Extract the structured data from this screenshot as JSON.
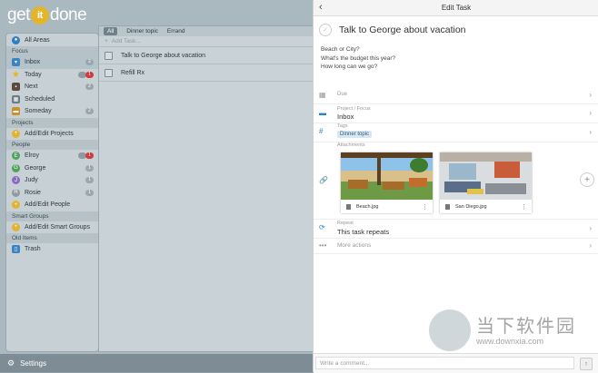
{
  "app": {
    "logo_left": "get",
    "logo_it": "it",
    "logo_right": "done"
  },
  "sidebar": {
    "all_areas": "All Areas",
    "sections": {
      "focus": "Focus",
      "projects": "Projects",
      "people": "People",
      "smart_groups": "Smart Groups",
      "old_items": "Old Items"
    },
    "focus_items": [
      {
        "label": "Inbox",
        "badge": "2"
      },
      {
        "label": "Today",
        "badge": "1"
      },
      {
        "label": "Next",
        "badge": "2"
      },
      {
        "label": "Scheduled",
        "badge": ""
      },
      {
        "label": "Someday",
        "badge": "2"
      }
    ],
    "add_projects": "Add/Edit Projects",
    "people": [
      {
        "initial": "E",
        "label": "Elroy",
        "badge": "1"
      },
      {
        "initial": "G",
        "label": "George",
        "badge": "1"
      },
      {
        "initial": "J",
        "label": "Judy",
        "badge": "1"
      },
      {
        "initial": "R",
        "label": "Rosie",
        "badge": "1"
      }
    ],
    "add_people": "Add/Edit People",
    "add_smart_groups": "Add/Edit Smart Groups",
    "trash": "Trash",
    "colors": {
      "elroy": "#4fa35a",
      "george": "#4fa35a",
      "judy": "#8a6bc2",
      "rosie": "#8f9aa0"
    }
  },
  "main": {
    "tabs": [
      "All",
      "Dinner topic",
      "Errand"
    ],
    "add_task": "Add Task...",
    "tasks": [
      "Talk to George about vacation",
      "Refill Rx"
    ]
  },
  "footer": {
    "settings": "Settings"
  },
  "panel": {
    "header": "Edit Task",
    "title": "Talk to George about vacation",
    "notes": [
      "Beach or City?",
      "What's the budget this year?",
      "How long can we go?"
    ],
    "due_label": "Due",
    "project_label": "Project / Focus",
    "project_value": "Inbox",
    "tags_label": "Tags",
    "tag": "Dinner topic",
    "attachments_label": "Attachments",
    "attachments": [
      "Beach.jpg",
      "San Diego.jpg"
    ],
    "repeat_label": "Repeat",
    "repeat_value": "This task repeats",
    "more_actions": "More actions",
    "comment_placeholder": "Write a comment...",
    "accent": "#1f86c8"
  },
  "watermark": {
    "big": "当下软件园",
    "small": "www.downxia.com"
  }
}
